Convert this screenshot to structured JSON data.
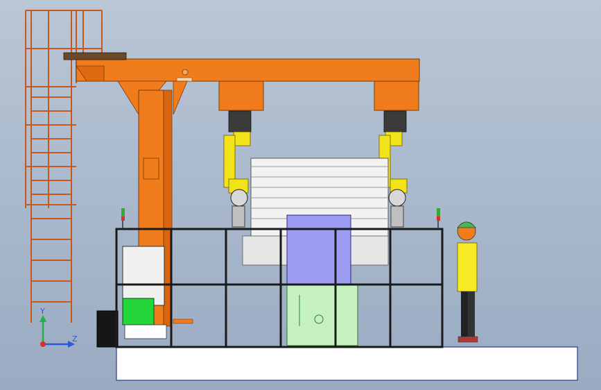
{
  "viewport": {
    "background_top": "#b9c6d6",
    "background_bottom": "#9aabc2"
  },
  "colors": {
    "structure_orange": "#f07c1c",
    "robot_yellow": "#f2e21a",
    "robot_dark": "#3b3b3b",
    "fence_black": "#1a1a1a",
    "panel_blue": "#9c9cf2",
    "panel_green": "#c5f2c0",
    "floor_white": "#ffffff",
    "operator_yellow": "#f5ea24",
    "operator_helmet": "#4fb15a",
    "tower_red": "#d9302b",
    "tower_green": "#3aa63a"
  },
  "triad": {
    "y_label": "Y",
    "z_label": "Z"
  },
  "icons": {
    "triad": "coordinate-triad-icon",
    "origin": "origin-dot-icon"
  }
}
